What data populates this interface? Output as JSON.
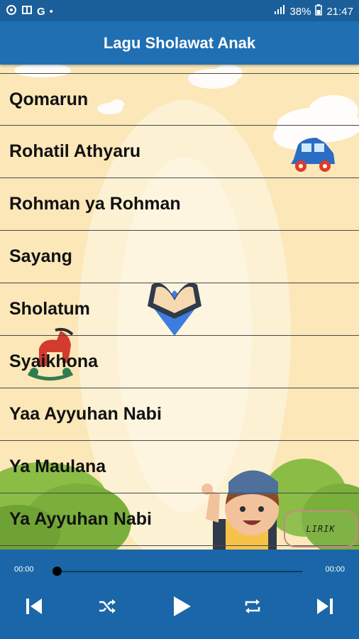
{
  "status_bar": {
    "left_icons": [
      "settings-icon",
      "quran-icon",
      "google-icon",
      "dot-icon"
    ],
    "signal": "signal-icon",
    "battery_percent": "38%",
    "time": "21:47"
  },
  "app_bar": {
    "title": "Lagu Sholawat Anak"
  },
  "songs": [
    "Qomarun",
    "Rohatil Athyaru",
    "Rohman ya Rohman",
    "Sayang",
    "Sholatum",
    "Syaikhona",
    "Yaa Ayyuhan Nabi",
    "Ya Maulana",
    "Ya Ayyuhan Nabi"
  ],
  "lirik_button": "LIRIK",
  "player": {
    "current_time": "00:00",
    "total_time": "00:00",
    "progress": 0,
    "controls": [
      "skip-previous-icon",
      "shuffle-icon",
      "play-icon",
      "repeat-icon",
      "skip-next-icon"
    ]
  },
  "colors": {
    "app_bar": "#1f6fb2",
    "status_bar": "#1a5f99",
    "player_bg": "#1a66a8",
    "list_bg": "#fbe7b8"
  }
}
